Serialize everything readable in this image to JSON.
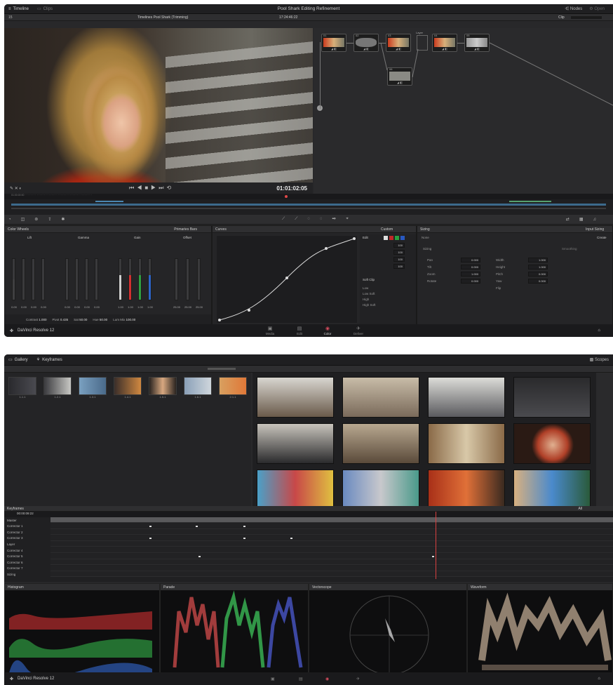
{
  "screen1": {
    "tabs": [
      {
        "icon": "timeline-icon",
        "label": "Timeline"
      },
      {
        "icon": "clips-icon",
        "label": "Clips"
      }
    ],
    "window_title": "Pool Shark Editing Refinement",
    "right_tabs": [
      "Nodes",
      "Open"
    ],
    "viewer_title": "Timelines Pool Shark (Trimming)",
    "viewer_timecode_top": "17:24:46:22",
    "viewer_zoom": "15",
    "clip_label": "Clip",
    "viewer_timecode": "01:01:02:05",
    "node_labels": [
      "01",
      "02",
      "03",
      "04",
      "05",
      "06"
    ],
    "layer_label": "Layer",
    "color_wheels": {
      "title": "Color Wheels",
      "mode": "Primaries Bars",
      "groups": [
        {
          "name": "Lift",
          "values": [
            "0.00",
            "0.00",
            "0.00",
            "0.00"
          ]
        },
        {
          "name": "Gamma",
          "values": [
            "0.00",
            "0.00",
            "0.00",
            "0.00"
          ]
        },
        {
          "name": "Gain",
          "values": [
            "1.00",
            "1.00",
            "1.00",
            "1.00"
          ]
        },
        {
          "name": "Offset",
          "values": [
            "25.00",
            "25.00",
            "25.00"
          ]
        }
      ],
      "channel_labels": [
        "Y",
        "R",
        "G",
        "B"
      ],
      "footer": [
        {
          "label": "Contrast",
          "value": "1.000"
        },
        {
          "label": "Pivot",
          "value": "0.435"
        },
        {
          "label": "Sat",
          "value": "50.00"
        },
        {
          "label": "Hue",
          "value": "50.00"
        },
        {
          "label": "Lum Mix",
          "value": "100.00"
        }
      ]
    },
    "curves": {
      "title": "Curves",
      "mode": "Custom"
    },
    "edit": {
      "title": "Edit",
      "values": [
        "100",
        "100",
        "100",
        "100"
      ],
      "soft_clip": "Soft Clip",
      "soft_clip_rows": [
        "Low",
        "Low Soft",
        "High",
        "High Soft"
      ]
    },
    "sizing": {
      "title": "Sizing",
      "mode": "Input Sizing",
      "preset": "None",
      "create": "Create",
      "section": "Sizing",
      "col1": [
        {
          "label": "Pan",
          "value": "0.000"
        },
        {
          "label": "Tilt",
          "value": "0.000"
        },
        {
          "label": "Zoom",
          "value": "1.000"
        },
        {
          "label": "Rotate",
          "value": "0.000"
        }
      ],
      "col2": [
        {
          "label": "Width",
          "value": "1.000"
        },
        {
          "label": "Height",
          "value": "1.000"
        },
        {
          "label": "Pitch",
          "value": "0.000"
        },
        {
          "label": "Yaw",
          "value": "0.000"
        },
        {
          "label": "Flip",
          "value": ""
        }
      ],
      "col3_title": "Smoothing"
    },
    "app_name": "DaVinci Resolve 12",
    "pages": [
      "Media",
      "Edit",
      "Color",
      "Deliver"
    ]
  },
  "screen2": {
    "tabs": [
      {
        "icon": "gallery-icon",
        "label": "Gallery"
      },
      {
        "icon": "keyframes-icon",
        "label": "Keyframes"
      }
    ],
    "right_tab": "Scopes",
    "stills": [
      {
        "caption": "1.1.1"
      },
      {
        "caption": "1.2.1"
      },
      {
        "caption": "1.3.1"
      },
      {
        "caption": "1.4.1"
      },
      {
        "caption": "1.5.1"
      },
      {
        "caption": "1.6.1"
      },
      {
        "caption": "2.1.1"
      }
    ],
    "keyframes": {
      "title": "Keyframes",
      "timecode": "00:00:09:22",
      "mode": "All",
      "rows": [
        "Master",
        "Corrector 1",
        "Corrector 2",
        "Corrector 3",
        "Layer",
        "Corrector 4",
        "Corrector 5",
        "Corrector 6",
        "Corrector 7",
        "Sizing"
      ]
    },
    "scopes": [
      {
        "name": "Histogram"
      },
      {
        "name": "Parade"
      },
      {
        "name": "Vectorscope"
      },
      {
        "name": "Waveform"
      }
    ],
    "app_name": "DaVinci Resolve 12"
  }
}
